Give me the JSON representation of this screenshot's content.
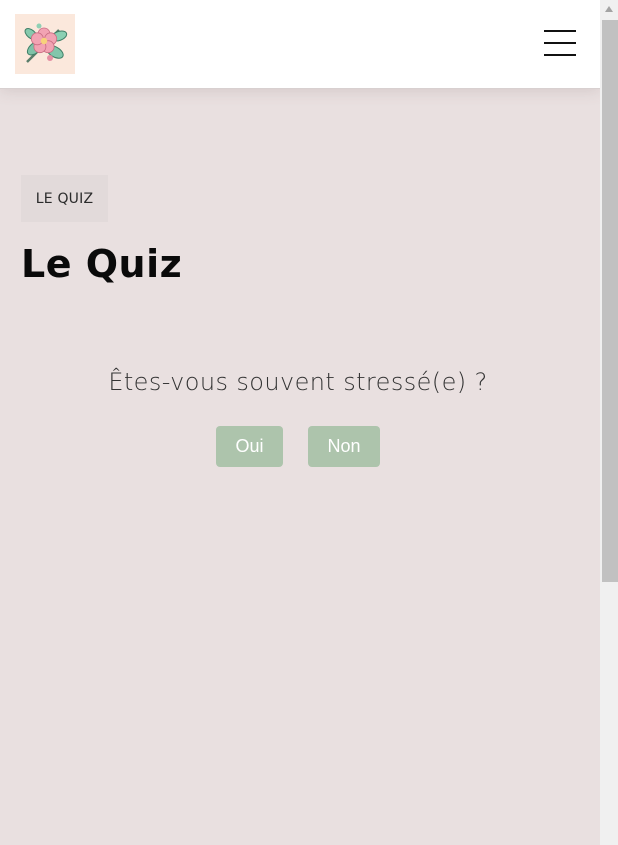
{
  "header": {
    "logo_alt": "flower-logo",
    "menu_icon": "hamburger-menu-icon"
  },
  "main": {
    "breadcrumb": "LE QUIZ",
    "title": "Le Quiz",
    "question": "Êtes-vous souvent stressé(e) ?",
    "answers": {
      "yes": "Oui",
      "no": "Non"
    }
  },
  "colors": {
    "page_background": "#e9e0e0",
    "button_background": "#adc4ac",
    "button_text": "#ffffff",
    "badge_background": "#e2dada"
  }
}
